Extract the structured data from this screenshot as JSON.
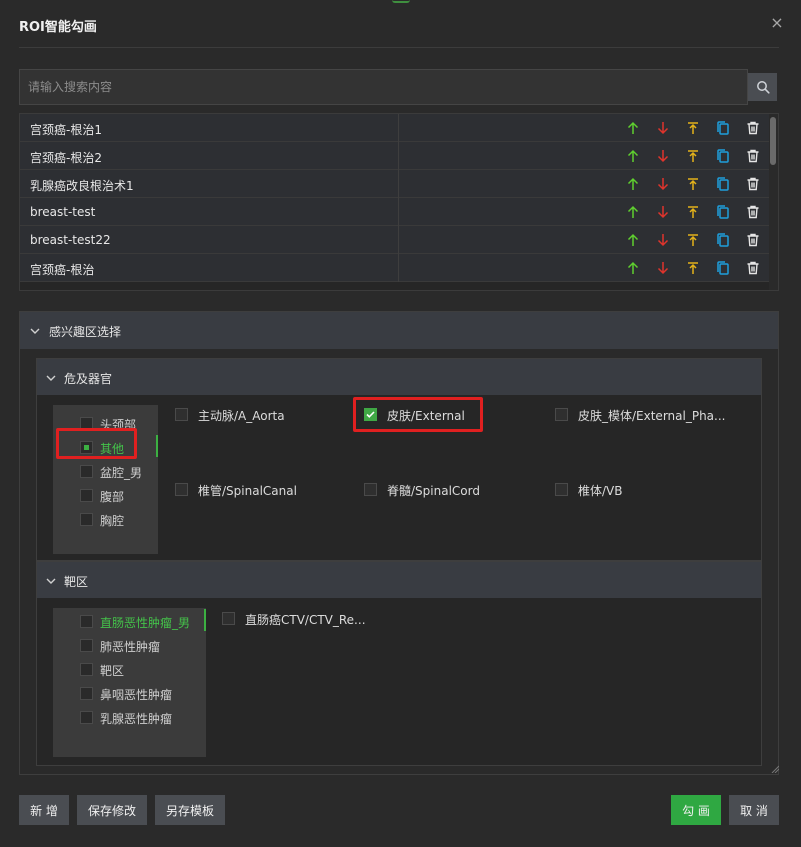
{
  "dialog": {
    "title": "ROI智能勾画",
    "close_glyph": "×"
  },
  "search": {
    "placeholder": "请输入搜索内容",
    "value": ""
  },
  "templates": {
    "rows": [
      {
        "name": "宫颈癌-根治1"
      },
      {
        "name": "宫颈癌-根治2"
      },
      {
        "name": "乳腺癌改良根治术1"
      },
      {
        "name": "breast-test"
      },
      {
        "name": "breast-test22"
      },
      {
        "name": "宫颈癌-根治"
      }
    ],
    "action_icons": [
      "arrow-up-icon",
      "arrow-down-icon",
      "move-to-top-icon",
      "copy-icon",
      "delete-icon"
    ],
    "action_colors": {
      "up": "#5fcf2f",
      "down": "#e0342c",
      "top": "#e3b21b",
      "copy": "#1e9fdc",
      "delete": "#e6e6e6"
    }
  },
  "roi_panel": {
    "title": "感兴趣区选择",
    "organs": {
      "title": "危及器官",
      "categories": [
        {
          "label": "头颈部",
          "active": false
        },
        {
          "label": "其他",
          "active": true
        },
        {
          "label": "盆腔_男",
          "active": false
        },
        {
          "label": "腹部",
          "active": false
        },
        {
          "label": "胸腔",
          "active": false
        }
      ],
      "options": [
        {
          "label": "主动脉/A_Aorta",
          "checked": false
        },
        {
          "label": "皮肤/External",
          "checked": true
        },
        {
          "label": "皮肤_模体/External_Pha...",
          "checked": false
        },
        {
          "label": "椎管/SpinalCanal",
          "checked": false
        },
        {
          "label": "脊髓/SpinalCord",
          "checked": false
        },
        {
          "label": "椎体/VB",
          "checked": false
        }
      ]
    },
    "targets": {
      "title": "靶区",
      "categories": [
        {
          "label": "直肠恶性肿瘤_男",
          "active": true
        },
        {
          "label": "肺恶性肿瘤",
          "active": false
        },
        {
          "label": "靶区",
          "active": false
        },
        {
          "label": "鼻咽恶性肿瘤",
          "active": false
        },
        {
          "label": "乳腺恶性肿瘤",
          "active": false
        }
      ],
      "options": [
        {
          "label": "直肠癌CTV/CTV_Re...",
          "checked": false
        }
      ]
    }
  },
  "footer": {
    "new_label": "新 增",
    "save_label": "保存修改",
    "save_as_label": "另存模板",
    "draw_label": "勾 画",
    "cancel_label": "取 消"
  },
  "colors": {
    "accent_green": "#2fa842",
    "highlight_red": "#e02020"
  }
}
